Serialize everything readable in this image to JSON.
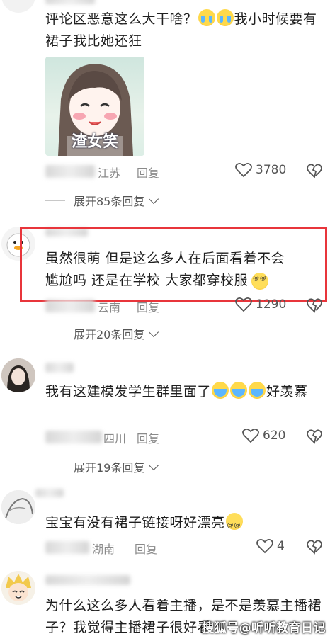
{
  "comments": [
    {
      "text": "评论区恶意这么大干啥？",
      "text_after": "我小时候要有裙子我比她还狂",
      "sticker_caption": "渣女笑",
      "location": "江苏",
      "reply": "回复",
      "likes": "3780",
      "expand": "展开85条回复"
    },
    {
      "text": "虽然很萌 但是这么多人在后面看着不会尴尬吗 还是在学校 大家都穿校服",
      "location": "云南",
      "reply": "回复",
      "likes": "1290",
      "expand": "展开20条回复"
    },
    {
      "text": "我有这建模发学生群里面了",
      "text_after": "好羡慕",
      "location": "四川",
      "reply": "回复",
      "likes": "620",
      "expand": "展开19条回复"
    },
    {
      "text": "宝宝有没有裙子链接呀好漂亮",
      "location": "湖南",
      "reply": "回复",
      "likes": "4"
    },
    {
      "text": "为什么这么多人看着主播，是不是羡慕主播裙子？我觉得主播裙子很好看"
    }
  ],
  "watermark": "搜狐号@听听教育日记",
  "colors": {
    "highlight_border": "#e8353b",
    "meta_text": "#8a8a8a",
    "body_text": "#1f1f1f"
  }
}
